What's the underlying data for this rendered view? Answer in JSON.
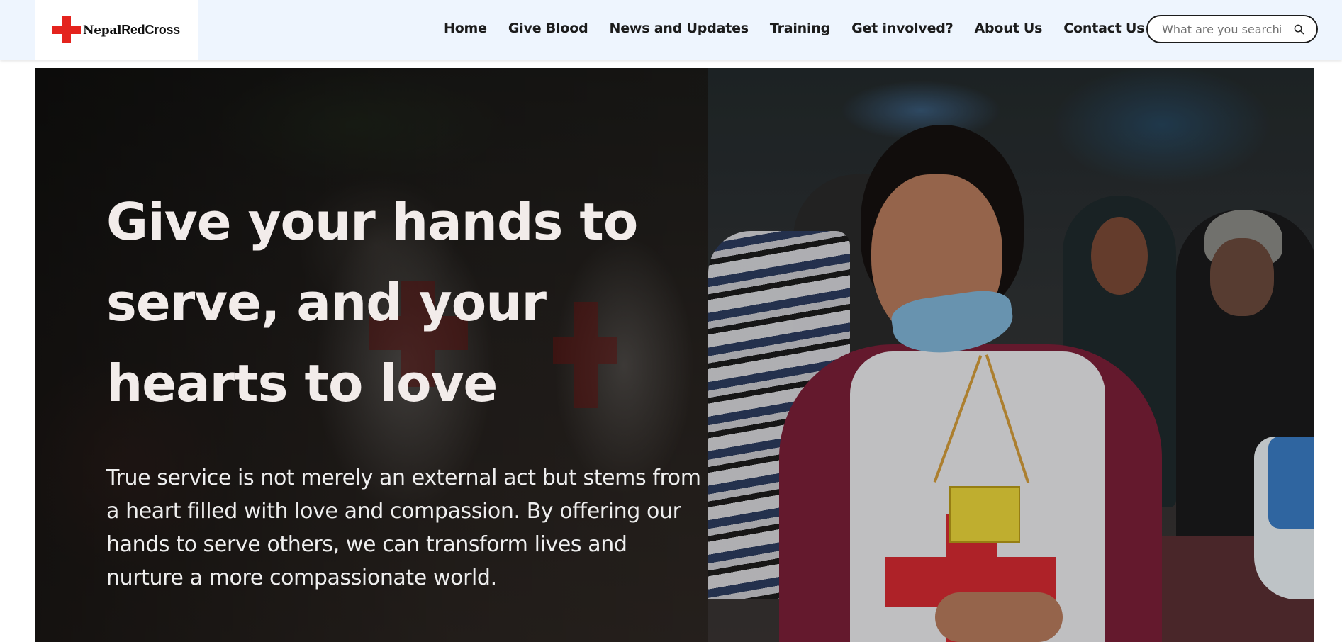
{
  "brand": {
    "name_part1": "Nepal",
    "name_part2": "RedCross",
    "accent_color": "#e4231d"
  },
  "nav": {
    "items": [
      {
        "label": "Home"
      },
      {
        "label": "Give Blood"
      },
      {
        "label": "News and Updates"
      },
      {
        "label": "Training"
      },
      {
        "label": "Get involved?"
      },
      {
        "label": "About Us"
      },
      {
        "label": "Contact Us"
      }
    ],
    "search": {
      "placeholder": "What are you searching for?",
      "value": "",
      "icon": "search-icon"
    }
  },
  "hero": {
    "title_lines": [
      "Give your hands to",
      "serve, and your",
      "hearts to love"
    ],
    "description": "True service is not merely an external act but stems from a heart filled with love and compassion. By offering our hands to serve others, we can transform lives and nurture a more compassionate world."
  }
}
